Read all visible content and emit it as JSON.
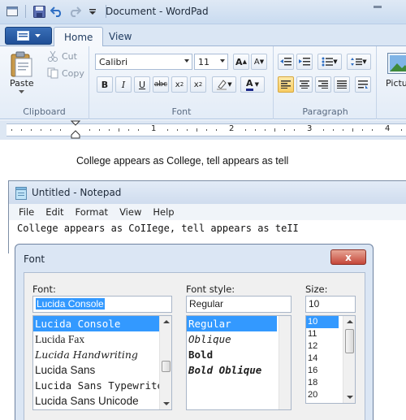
{
  "wordpad": {
    "title": "Document - WordPad",
    "tabs": [
      "Home",
      "View"
    ],
    "clipboard": {
      "paste": "Paste",
      "cut": "Cut",
      "copy": "Copy",
      "group": "Clipboard"
    },
    "font": {
      "family": "Calibri",
      "size": "11",
      "group": "Font"
    },
    "paragraph": {
      "group": "Paragraph"
    },
    "insert": {
      "picture": "Pictu"
    },
    "ruler_marks": [
      "1",
      "2",
      "3",
      "4"
    ],
    "document_text": "College appears as College, tell appears as tell"
  },
  "notepad": {
    "title": "Untitled - Notepad",
    "menu": [
      "File",
      "Edit",
      "Format",
      "View",
      "Help"
    ],
    "text": "College appears as CoIIege, tell appears as teII"
  },
  "font_dialog": {
    "title": "Font",
    "close_label": "x",
    "font_label": "Font:",
    "font_value": "Lucida Console",
    "fonts": [
      "Lucida Console",
      "Lucida Fax",
      "Lucida Handwriting",
      "Lucida Sans",
      "Lucida Sans Typewriter",
      "Lucida Sans Unicode"
    ],
    "style_label": "Font style:",
    "style_value": "Regular",
    "styles": [
      "Regular",
      "Oblique",
      "Bold",
      "Bold Oblique"
    ],
    "size_label": "Size:",
    "size_value": "10",
    "sizes": [
      "10",
      "11",
      "12",
      "14",
      "16",
      "18",
      "20"
    ]
  },
  "colors": {
    "accent": "#3399ff",
    "ribbon_bg": "#e3ecf7",
    "app_button": "#2a5ea8",
    "close": "#c4473a"
  }
}
